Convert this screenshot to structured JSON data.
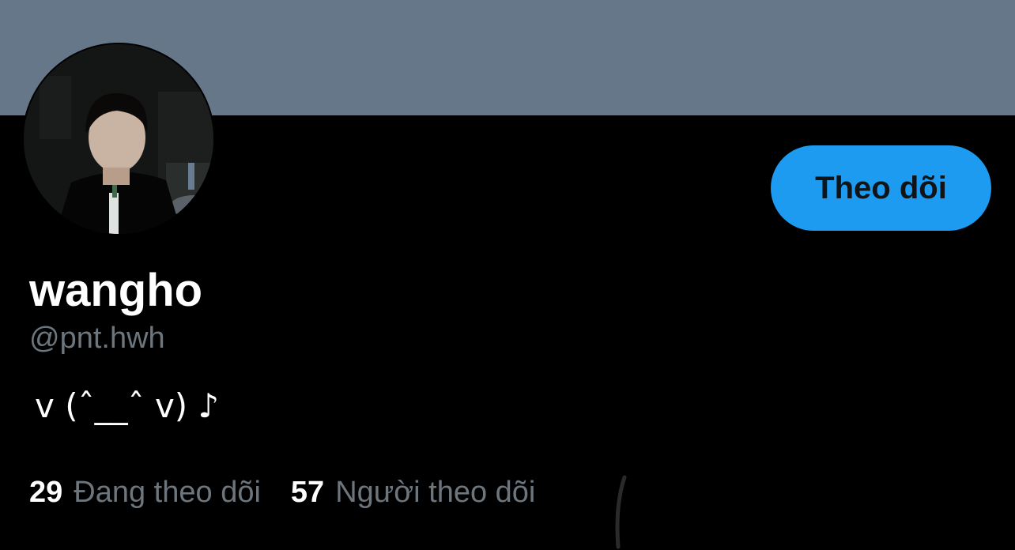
{
  "profile": {
    "display_name": "wangho",
    "handle": "@pnt.hwh",
    "bio": "v (ˆ__ˆ v) ♪",
    "follow_button_label": "Theo dõi"
  },
  "stats": {
    "following_count": "29",
    "following_label": "Đang theo dõi",
    "followers_count": "57",
    "followers_label": "Người theo dõi"
  },
  "colors": {
    "banner": "#66778a",
    "background": "#000000",
    "accent": "#1d9bf0",
    "secondary_text": "#6e767d"
  }
}
